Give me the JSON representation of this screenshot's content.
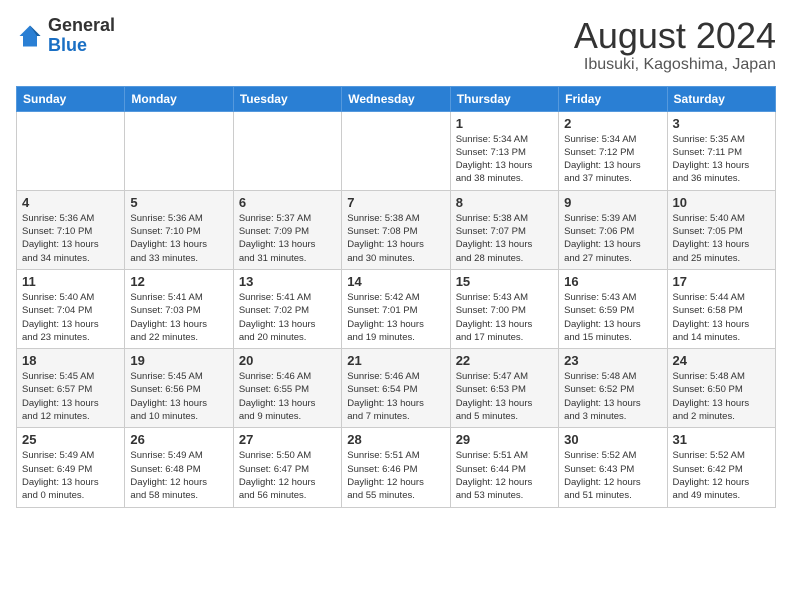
{
  "header": {
    "logo_general": "General",
    "logo_blue": "Blue",
    "month_title": "August 2024",
    "location": "Ibusuki, Kagoshima, Japan"
  },
  "weekdays": [
    "Sunday",
    "Monday",
    "Tuesday",
    "Wednesday",
    "Thursday",
    "Friday",
    "Saturday"
  ],
  "weeks": [
    [
      {
        "day": "",
        "info": ""
      },
      {
        "day": "",
        "info": ""
      },
      {
        "day": "",
        "info": ""
      },
      {
        "day": "",
        "info": ""
      },
      {
        "day": "1",
        "info": "Sunrise: 5:34 AM\nSunset: 7:13 PM\nDaylight: 13 hours\nand 38 minutes."
      },
      {
        "day": "2",
        "info": "Sunrise: 5:34 AM\nSunset: 7:12 PM\nDaylight: 13 hours\nand 37 minutes."
      },
      {
        "day": "3",
        "info": "Sunrise: 5:35 AM\nSunset: 7:11 PM\nDaylight: 13 hours\nand 36 minutes."
      }
    ],
    [
      {
        "day": "4",
        "info": "Sunrise: 5:36 AM\nSunset: 7:10 PM\nDaylight: 13 hours\nand 34 minutes."
      },
      {
        "day": "5",
        "info": "Sunrise: 5:36 AM\nSunset: 7:10 PM\nDaylight: 13 hours\nand 33 minutes."
      },
      {
        "day": "6",
        "info": "Sunrise: 5:37 AM\nSunset: 7:09 PM\nDaylight: 13 hours\nand 31 minutes."
      },
      {
        "day": "7",
        "info": "Sunrise: 5:38 AM\nSunset: 7:08 PM\nDaylight: 13 hours\nand 30 minutes."
      },
      {
        "day": "8",
        "info": "Sunrise: 5:38 AM\nSunset: 7:07 PM\nDaylight: 13 hours\nand 28 minutes."
      },
      {
        "day": "9",
        "info": "Sunrise: 5:39 AM\nSunset: 7:06 PM\nDaylight: 13 hours\nand 27 minutes."
      },
      {
        "day": "10",
        "info": "Sunrise: 5:40 AM\nSunset: 7:05 PM\nDaylight: 13 hours\nand 25 minutes."
      }
    ],
    [
      {
        "day": "11",
        "info": "Sunrise: 5:40 AM\nSunset: 7:04 PM\nDaylight: 13 hours\nand 23 minutes."
      },
      {
        "day": "12",
        "info": "Sunrise: 5:41 AM\nSunset: 7:03 PM\nDaylight: 13 hours\nand 22 minutes."
      },
      {
        "day": "13",
        "info": "Sunrise: 5:41 AM\nSunset: 7:02 PM\nDaylight: 13 hours\nand 20 minutes."
      },
      {
        "day": "14",
        "info": "Sunrise: 5:42 AM\nSunset: 7:01 PM\nDaylight: 13 hours\nand 19 minutes."
      },
      {
        "day": "15",
        "info": "Sunrise: 5:43 AM\nSunset: 7:00 PM\nDaylight: 13 hours\nand 17 minutes."
      },
      {
        "day": "16",
        "info": "Sunrise: 5:43 AM\nSunset: 6:59 PM\nDaylight: 13 hours\nand 15 minutes."
      },
      {
        "day": "17",
        "info": "Sunrise: 5:44 AM\nSunset: 6:58 PM\nDaylight: 13 hours\nand 14 minutes."
      }
    ],
    [
      {
        "day": "18",
        "info": "Sunrise: 5:45 AM\nSunset: 6:57 PM\nDaylight: 13 hours\nand 12 minutes."
      },
      {
        "day": "19",
        "info": "Sunrise: 5:45 AM\nSunset: 6:56 PM\nDaylight: 13 hours\nand 10 minutes."
      },
      {
        "day": "20",
        "info": "Sunrise: 5:46 AM\nSunset: 6:55 PM\nDaylight: 13 hours\nand 9 minutes."
      },
      {
        "day": "21",
        "info": "Sunrise: 5:46 AM\nSunset: 6:54 PM\nDaylight: 13 hours\nand 7 minutes."
      },
      {
        "day": "22",
        "info": "Sunrise: 5:47 AM\nSunset: 6:53 PM\nDaylight: 13 hours\nand 5 minutes."
      },
      {
        "day": "23",
        "info": "Sunrise: 5:48 AM\nSunset: 6:52 PM\nDaylight: 13 hours\nand 3 minutes."
      },
      {
        "day": "24",
        "info": "Sunrise: 5:48 AM\nSunset: 6:50 PM\nDaylight: 13 hours\nand 2 minutes."
      }
    ],
    [
      {
        "day": "25",
        "info": "Sunrise: 5:49 AM\nSunset: 6:49 PM\nDaylight: 13 hours\nand 0 minutes."
      },
      {
        "day": "26",
        "info": "Sunrise: 5:49 AM\nSunset: 6:48 PM\nDaylight: 12 hours\nand 58 minutes."
      },
      {
        "day": "27",
        "info": "Sunrise: 5:50 AM\nSunset: 6:47 PM\nDaylight: 12 hours\nand 56 minutes."
      },
      {
        "day": "28",
        "info": "Sunrise: 5:51 AM\nSunset: 6:46 PM\nDaylight: 12 hours\nand 55 minutes."
      },
      {
        "day": "29",
        "info": "Sunrise: 5:51 AM\nSunset: 6:44 PM\nDaylight: 12 hours\nand 53 minutes."
      },
      {
        "day": "30",
        "info": "Sunrise: 5:52 AM\nSunset: 6:43 PM\nDaylight: 12 hours\nand 51 minutes."
      },
      {
        "day": "31",
        "info": "Sunrise: 5:52 AM\nSunset: 6:42 PM\nDaylight: 12 hours\nand 49 minutes."
      }
    ]
  ]
}
